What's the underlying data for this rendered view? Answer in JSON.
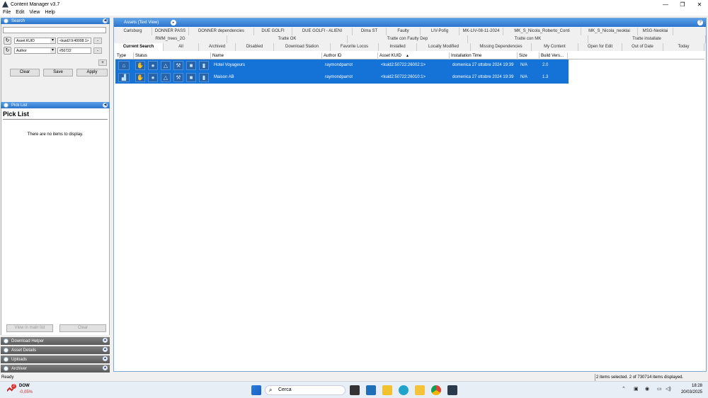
{
  "window": {
    "title": "Content Manager v3.7"
  },
  "menu": [
    "File",
    "Edit",
    "View",
    "Help"
  ],
  "search_panel": {
    "title": "Search",
    "filters": [
      {
        "field": "Asset KUID",
        "value": "<kuid2:9:40008:1>"
      },
      {
        "field": "Author",
        "value": "#50722"
      }
    ],
    "buttons": {
      "clear": "Clear",
      "save": "Save",
      "apply": "Apply"
    }
  },
  "pick_list": {
    "panel_title": "Pick List",
    "heading": "Pick List",
    "empty_text": "There are no items to display.",
    "view_in_main": "View in main list",
    "clear": "Clear"
  },
  "bottom_panels": [
    "Download Helper",
    "Asset Details",
    "Uploads",
    "Archiver"
  ],
  "assets": {
    "title": "Assets (Text View)",
    "tabs_row1": [
      "Carlsburg",
      "DONNER PASS",
      "DONNER dependencies",
      "DUE GOLFI",
      "DUE GOLFI - ALIENI",
      "Dima ST",
      "Faulty",
      "LIV-Pofig",
      "MK-LIV-08-11-2024",
      "MK_S_Nicola_Roberto_Conti",
      "MK_S_Nicola_neoklai",
      "MSG-Neoklai"
    ],
    "tabs_row2": [
      "RMM_trees_2G",
      "Tratte OK",
      "Tratte con Faulty Dep",
      "Tratte con MK",
      "Tratte installate"
    ],
    "tabs_row3": [
      "Current Search",
      "All",
      "Archived",
      "Disabled",
      "Download Station",
      "Favorite Locos",
      "Installed",
      "Locally Modified",
      "Missing Dependencies",
      "My Content",
      "Open for Edit",
      "Out of Date",
      "Today"
    ],
    "columns": [
      "Type",
      "Status",
      "Name",
      "Author ID",
      "Asset KUID",
      "Installation Time",
      "Size",
      "Build Vers..."
    ],
    "rows": [
      {
        "type_icon": "house-icon",
        "name": "Hotel Voyageurs",
        "author": "raymondparrot",
        "kuid": "<kuid2:50722:26002:1>",
        "installed": "domenica 27 ottobre 2024 19:39",
        "size": "N/A",
        "build": "2.0"
      },
      {
        "type_icon": "building-icon",
        "name": "Maison AB",
        "author": "raymondparrot",
        "kuid": "<kuid2:50722:26010:1>",
        "installed": "domenica 27 ottobre 2024 19:39",
        "size": "N/A",
        "build": "1.3"
      }
    ],
    "status_icons": [
      "hand-icon",
      "circle-icon",
      "warning-icon",
      "tools-icon",
      "briefcase-icon",
      "bottle-icon"
    ]
  },
  "statusbar": {
    "left": "Ready",
    "right": "2 items selected. 2 of 730714 items displayed."
  },
  "taskbar": {
    "stock_name": "DOW",
    "stock_change": "-0,05%",
    "stock_badge": "2",
    "search_placeholder": "Cerca",
    "time": "18:28",
    "date": "20/03/2025"
  },
  "colors": {
    "accent": "#2b74cc",
    "selection": "#1573d8"
  }
}
